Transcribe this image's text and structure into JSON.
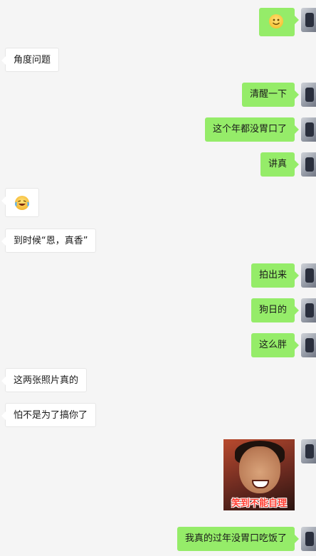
{
  "messages": [
    {
      "id": "m1",
      "side": "right",
      "type": "emoji",
      "emoji": "smile-icon"
    },
    {
      "id": "m2",
      "side": "left",
      "type": "text",
      "text": "角度问题"
    },
    {
      "id": "m3",
      "side": "right",
      "type": "text",
      "text": "清醒一下"
    },
    {
      "id": "m4",
      "side": "right",
      "type": "text",
      "text": "这个年都没胃口了"
    },
    {
      "id": "m5",
      "side": "right",
      "type": "text",
      "text": "讲真"
    },
    {
      "id": "m6",
      "side": "left",
      "type": "emoji",
      "emoji": "laughing-crying-icon"
    },
    {
      "id": "m7",
      "side": "left",
      "type": "text",
      "text": "到时候“恩，真香”"
    },
    {
      "id": "m8",
      "side": "right",
      "type": "text",
      "text": "拍出来"
    },
    {
      "id": "m9",
      "side": "right",
      "type": "text",
      "text": "狗日的"
    },
    {
      "id": "m10",
      "side": "right",
      "type": "text",
      "text": "这么胖"
    },
    {
      "id": "m11",
      "side": "left",
      "type": "text",
      "text": "这两张照片真的"
    },
    {
      "id": "m12",
      "side": "left",
      "type": "text",
      "text": "怕不是为了搞你了"
    },
    {
      "id": "m13",
      "side": "right",
      "type": "sticker",
      "caption": "笑到不能自理"
    },
    {
      "id": "m14",
      "side": "right",
      "type": "text",
      "text": "我真的过年没胃口吃饭了"
    }
  ],
  "colors": {
    "self_bubble": "#95ec69",
    "other_bubble": "#ffffff",
    "background": "#f5f5f5"
  }
}
